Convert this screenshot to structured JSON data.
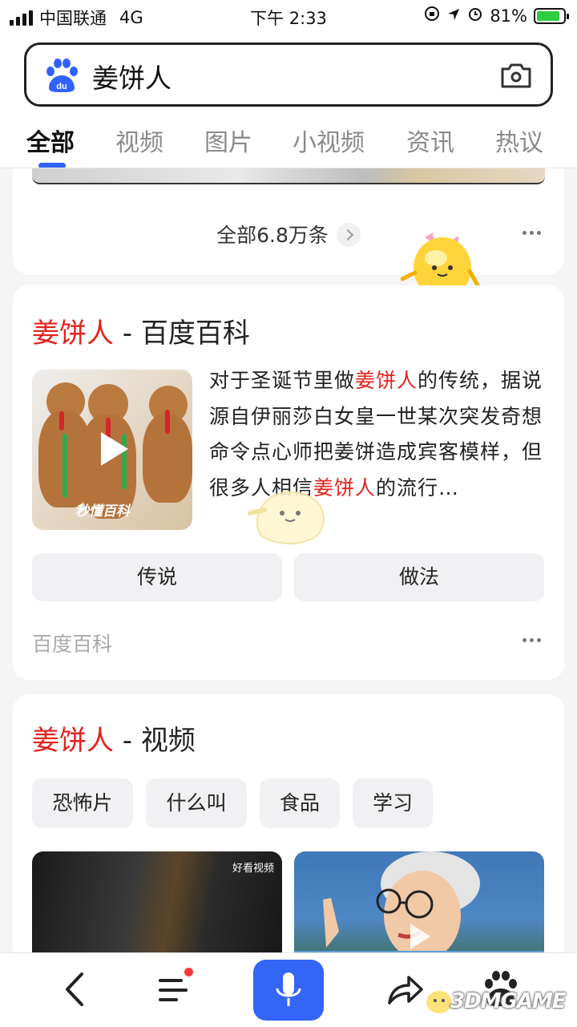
{
  "status_bar": {
    "carrier": "中国联通",
    "network": "4G",
    "time": "下午 2:33",
    "battery": "81%"
  },
  "search": {
    "query": "姜饼人"
  },
  "tabs": [
    {
      "label": "全部"
    },
    {
      "label": "视频"
    },
    {
      "label": "图片"
    },
    {
      "label": "小视频"
    },
    {
      "label": "资讯"
    },
    {
      "label": "热议"
    }
  ],
  "results_summary": {
    "label": "全部6.8万条"
  },
  "baike_card": {
    "title_keyword": "姜饼人",
    "title_suffix": " - 百度百科",
    "desc_part1": "对于圣诞节里做",
    "desc_kw1": "姜饼人",
    "desc_part2": "的传统，据说源自伊丽莎白女皇一世某次突发奇想命令点心师把姜饼造成宾客模样，但很多人相信",
    "desc_kw2": "姜饼人",
    "desc_part3": "的流行…",
    "thumb_watermark": "秒懂百科",
    "buttons": [
      "传说",
      "做法"
    ],
    "source": "百度百科"
  },
  "video_card": {
    "title_keyword": "姜饼人",
    "title_suffix": " - 视频",
    "chips": [
      "恐怖片",
      "什么叫",
      "食品",
      "学习"
    ],
    "video1_source": "好看视频"
  },
  "watermark": "3DMGAME"
}
